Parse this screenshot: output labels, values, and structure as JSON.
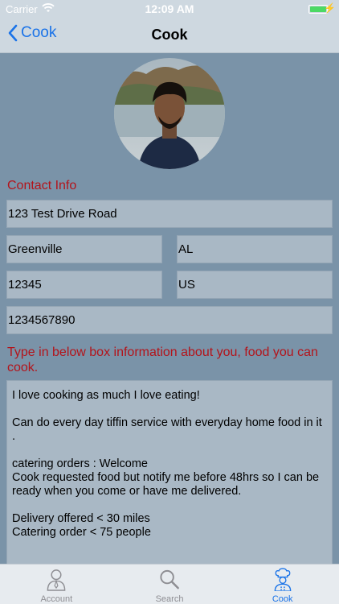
{
  "status_bar": {
    "carrier": "Carrier",
    "time": "12:09 AM",
    "battery_level": 1.0
  },
  "nav": {
    "back_label": "Cook",
    "title": "Cook"
  },
  "contact": {
    "heading": "Contact Info",
    "address": "123 Test Drive Road",
    "city": "Greenville",
    "state": "AL",
    "zip": "12345",
    "country": "US",
    "phone": "1234567890"
  },
  "about": {
    "heading": "Type in below box information about you, food you can cook.",
    "text": "I love cooking as much I love eating!\n\nCan do every day tiffin service with everyday home food in it .\n\ncatering orders : Welcome\nCook requested food but notify me before 48hrs so I can be ready when you come or have me delivered.\n\nDelivery offered < 30 miles\nCatering order < 75 people"
  },
  "tabs": [
    {
      "label": "Account",
      "icon": "person-icon",
      "active": false
    },
    {
      "label": "Search",
      "icon": "search-icon",
      "active": false
    },
    {
      "label": "Cook",
      "icon": "chef-icon",
      "active": true
    }
  ],
  "colors": {
    "accent": "#1a73e8",
    "heading_red": "#b3141b",
    "background": "#7a93a8",
    "field": "#a9b8c5"
  }
}
